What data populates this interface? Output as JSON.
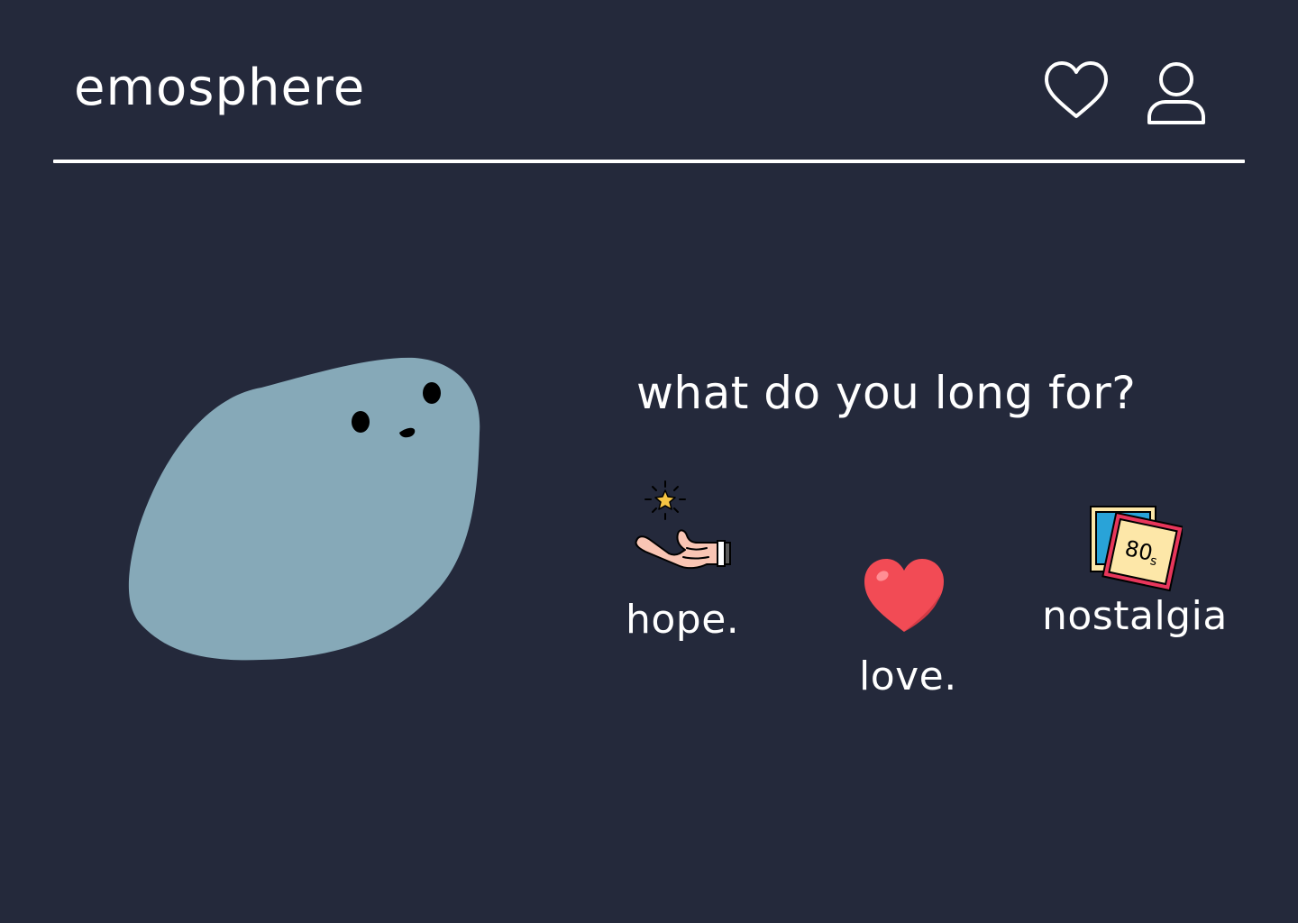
{
  "app": {
    "brand": "emosphere"
  },
  "header": {
    "icons": [
      "heart-outline-icon",
      "user-icon"
    ]
  },
  "main": {
    "question": "what do you long for?",
    "options": [
      {
        "label": "hope.",
        "icon": "hand-star-icon"
      },
      {
        "label": "love.",
        "icon": "red-heart-icon"
      },
      {
        "label": "nostalgia",
        "icon": "photos-80s-icon"
      }
    ]
  },
  "colors": {
    "background": "#24293b",
    "text": "#ffffff",
    "mascot": "#86a9b8",
    "heart": "#f24b55"
  }
}
